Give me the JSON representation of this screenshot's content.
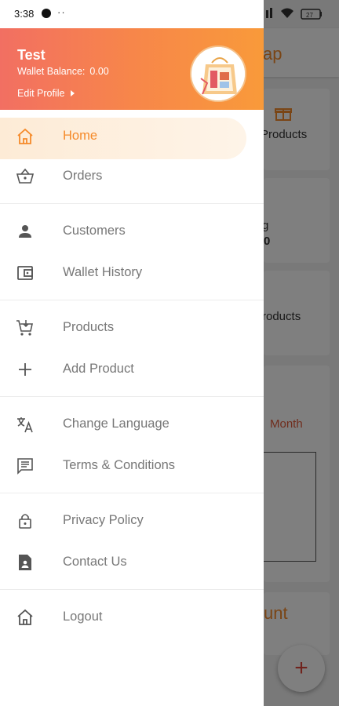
{
  "status_bar": {
    "time": "3:38",
    "dots": "··",
    "battery": "27"
  },
  "drawer": {
    "user_name": "Test",
    "wallet_label": "Wallet Balance:",
    "wallet_value": "0.00",
    "edit_profile": "Edit Profile",
    "menu": [
      {
        "label": "Home",
        "icon": "home-icon",
        "active": true
      },
      {
        "label": "Orders",
        "icon": "basket-icon"
      },
      {
        "label": "Customers",
        "icon": "person-icon"
      },
      {
        "label": "Wallet History",
        "icon": "wallet-icon"
      },
      {
        "label": "Products",
        "icon": "cart-icon"
      },
      {
        "label": "Add Product",
        "icon": "plus-icon"
      },
      {
        "label": "Change Language",
        "icon": "translate-icon"
      },
      {
        "label": "Terms & Conditions",
        "icon": "document-list-icon"
      },
      {
        "label": "Privacy Policy",
        "icon": "lock-icon"
      },
      {
        "label": "Contact Us",
        "icon": "contact-file-icon"
      },
      {
        "label": "Logout",
        "icon": "home-icon"
      }
    ]
  },
  "background": {
    "header_title_fragment": "ap",
    "products_label": "Products",
    "card2_line1": "g",
    "card2_line2": "0",
    "card3_label": "roducts",
    "month_label": "Month",
    "count_title_fragment": "unt",
    "fab_symbol": "+"
  },
  "colors": {
    "accent": "#f58a2a",
    "header_start": "#f26f62",
    "header_end": "#f99a3a"
  }
}
